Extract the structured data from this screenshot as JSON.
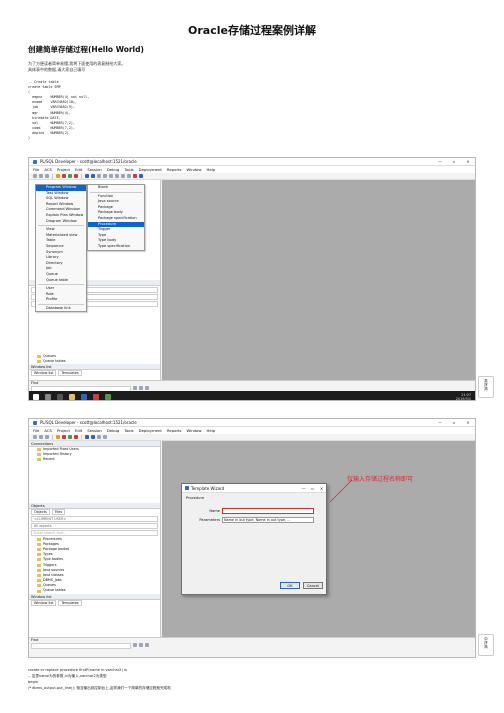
{
  "doc": {
    "title": "Oracle存储过程案例详解",
    "section_heading": "创建简单存储过程(Hello World)",
    "intro_lines": [
      "为了方便读者简单易懂,我将下面使用的表复制给大家。",
      "具体表中的数据,请大家自己填写"
    ],
    "code_lines": [
      "-- Create table",
      "create table EMP",
      "(",
      "  empno    NUMBER(4) not null,",
      "  ename    VARCHAR2(10),",
      "  job      VARCHAR2(9),",
      "  mgr      NUMBER(4),",
      "  hiredate DATE,",
      "  sal      NUMBER(7,2),",
      "  comm     NUMBER(7,2),",
      "  deptno   NUMBER(2)",
      ")"
    ],
    "footer_lines": [
      "create or replace procedure firstP(name in varchar2) is",
      "-- 这里name为的参数,in为输入,varchar2为类型",
      "begin",
      "/* dbms_output.put_line(); 相当输出到控制台上,这样我们一个简单的存储过程就完成啦"
    ]
  },
  "shot1": {
    "window_title": "PL/SQL Developer - scott@localhost:1521/oracle",
    "menu_items": [
      "File",
      "ACS",
      "Project",
      "Edit",
      "Session",
      "Debug",
      "Tools",
      "Deployment",
      "Reports",
      "Window",
      "Help"
    ],
    "new_menu": [
      {
        "label": "Program Window",
        "highlight": true
      },
      {
        "label": "Test Window"
      },
      {
        "label": "SQL Window"
      },
      {
        "label": "Report Window"
      },
      {
        "label": "Command Window"
      },
      {
        "label": "Explain Plan Window"
      },
      {
        "label": "Diagram Window"
      },
      {
        "sep": true
      },
      {
        "label": "View"
      },
      {
        "label": "Materialized view"
      },
      {
        "label": "Table"
      },
      {
        "label": "Sequence"
      },
      {
        "label": "Synonym"
      },
      {
        "label": "Library"
      },
      {
        "label": "Directory"
      },
      {
        "label": "Job"
      },
      {
        "label": "Queue"
      },
      {
        "label": "Queue table"
      },
      {
        "sep": true
      },
      {
        "label": "User"
      },
      {
        "label": "Role"
      },
      {
        "label": "Profile"
      },
      {
        "sep": true
      },
      {
        "label": "Database link"
      }
    ],
    "sub_menu": [
      {
        "label": "Blank"
      },
      {
        "sep": true
      },
      {
        "label": "Function"
      },
      {
        "label": "Java source"
      },
      {
        "label": "Package"
      },
      {
        "label": "Package body"
      },
      {
        "label": "Package specification"
      },
      {
        "label": "Procedure",
        "highlight": true
      },
      {
        "label": "Trigger"
      },
      {
        "label": "Type"
      },
      {
        "label": "Type body"
      },
      {
        "label": "Type specification"
      }
    ],
    "tree_items": [
      "Queues",
      "Queue tables"
    ],
    "window_list_label": "Window list",
    "window_list_tabs": [
      "Window list",
      "Templates"
    ],
    "find_label": "Find",
    "taskbar_time": "21:07",
    "taskbar_date": "2019/3/1",
    "badge_text": "英\n拼\n简"
  },
  "shot2": {
    "window_title": "PL/SQL Developer - scott@localhost:1521/oracle",
    "menu_items": [
      "File",
      "ACS",
      "Project",
      "Edit",
      "Session",
      "Debug",
      "Tools",
      "Deployment",
      "Reports",
      "Window",
      "Help"
    ],
    "connections_label": "Connections",
    "connection_items": [
      "Imported Fixed Users",
      "Imported History",
      "Recent"
    ],
    "objects_label": "Objects",
    "objects_tabs": [
      "Objects",
      "Files"
    ],
    "current_user": "<CURRENT USER>",
    "all_objects": "All objects",
    "search_placeholder": "Enter search text...",
    "object_folders": [
      "Procedures",
      "Packages",
      "Package bodies",
      "Types",
      "Type bodies",
      "Triggers",
      "Java sources",
      "Java classes",
      "DBMS_Jobs",
      "Queues",
      "Queue tables"
    ],
    "window_list_label": "Window list",
    "window_list_tabs": [
      "Window list",
      "Templates"
    ],
    "find_label": "Find",
    "dialog_title": "Template Wizard",
    "dialog_group": "Procedure",
    "name_label": "Name",
    "name_value": "",
    "parameters_label": "Parameters",
    "parameters_value": "Name in out type, Name in out type, ...",
    "ok_label": "OK",
    "cancel_label": "Cancel",
    "annotation": "仅输入存储过程名称即可",
    "badge_text": "中\n拼\n简"
  },
  "colors": {
    "highlight": "#0a64d2",
    "annotation": "#e0282e"
  }
}
